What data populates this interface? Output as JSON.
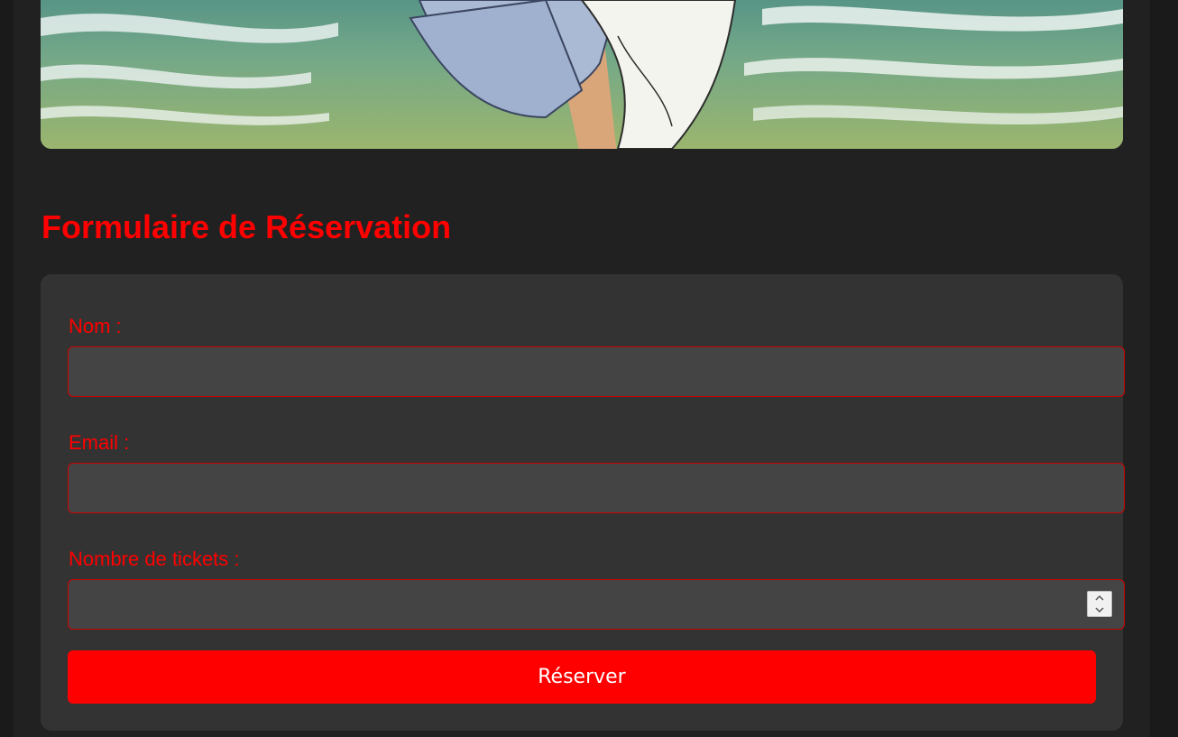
{
  "form": {
    "title": "Formulaire de Réservation",
    "fields": [
      {
        "label": "Nom :",
        "value": "",
        "placeholder": "",
        "type": "text"
      },
      {
        "label": "Email :",
        "value": "",
        "placeholder": "",
        "type": "email"
      },
      {
        "label": "Nombre de tickets :",
        "value": "",
        "placeholder": "",
        "type": "number"
      }
    ],
    "submit_label": "Réserver"
  },
  "colors": {
    "accent": "#ff0000",
    "page_background": "#212121",
    "card_background": "#333333",
    "input_background": "#444444",
    "input_border": "#cc0000"
  },
  "icons": {
    "spinner_up": "chevron-up-icon",
    "spinner_down": "chevron-down-icon"
  }
}
